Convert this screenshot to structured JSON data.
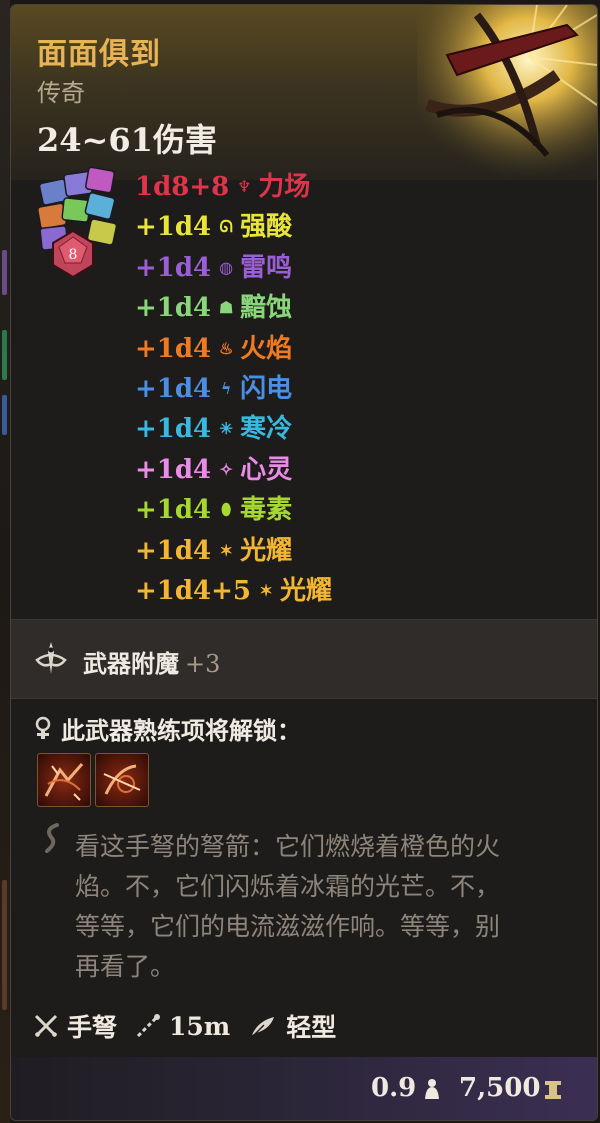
{
  "item": {
    "name": "面面俱到",
    "rarity": "传奇",
    "damage_range": "24~61伤害"
  },
  "damage_rows": [
    {
      "amount": "1d8+8",
      "icon": "force-icon",
      "glyph": "♆",
      "type": "力场",
      "color": "#e0344a"
    },
    {
      "amount": "+1d4",
      "icon": "acid-icon",
      "glyph": "ᘏ",
      "type": "强酸",
      "color": "#e8e43a"
    },
    {
      "amount": "+1d4",
      "icon": "thunder-icon",
      "glyph": "◍",
      "type": "雷鸣",
      "color": "#9a5fd6"
    },
    {
      "amount": "+1d4",
      "icon": "necrotic-icon",
      "glyph": "☗",
      "type": "黯蚀",
      "color": "#8ad67a"
    },
    {
      "amount": "+1d4",
      "icon": "fire-icon",
      "glyph": "♨",
      "type": "火焰",
      "color": "#f07a22"
    },
    {
      "amount": "+1d4",
      "icon": "lightning-icon",
      "glyph": "ϟ",
      "type": "闪电",
      "color": "#4a8ee6"
    },
    {
      "amount": "+1d4",
      "icon": "cold-icon",
      "glyph": "✳",
      "type": "寒冷",
      "color": "#38b9e0"
    },
    {
      "amount": "+1d4",
      "icon": "psychic-icon",
      "glyph": "✧",
      "type": "心灵",
      "color": "#e88ce8"
    },
    {
      "amount": "+1d4",
      "icon": "poison-icon",
      "glyph": "⬮",
      "type": "毒素",
      "color": "#a6d830"
    },
    {
      "amount": "+1d4",
      "icon": "radiant-icon",
      "glyph": "✶",
      "type": "光耀",
      "color": "#f2b632"
    },
    {
      "amount": "+1d4+5",
      "icon": "radiant-icon",
      "glyph": "✶",
      "type": "光耀",
      "color": "#f2b632"
    }
  ],
  "dice_badge": "8",
  "enchant": {
    "label": "武器附魔",
    "value": "+3"
  },
  "proficiency": {
    "title": "此武器熟练项将解锁："
  },
  "flavor": [
    "看这手弩的弩箭：它们燃烧着橙色的火",
    "焰。不，它们闪烁着冰霜的光芒。不，",
    "等等，它们的电流滋滋作响。等等，别",
    "再看了。"
  ],
  "properties": {
    "weapon_type": "手弩",
    "range": "15m",
    "weight_class": "轻型"
  },
  "footer": {
    "weight": "0.9",
    "value": "7,500"
  },
  "colors": {
    "title_gold": "#e7b455",
    "rarity_grey": "#b7a98f"
  }
}
